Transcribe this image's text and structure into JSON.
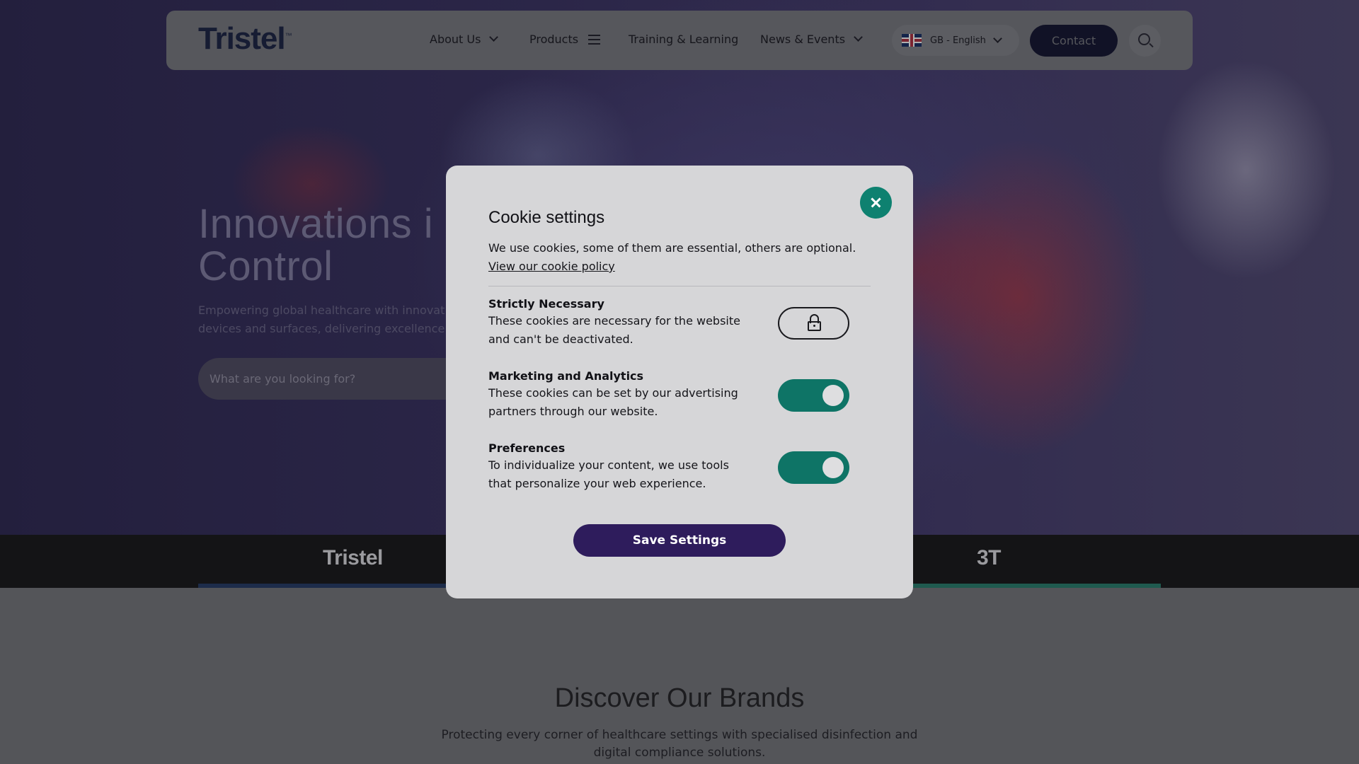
{
  "nav": {
    "logo": "Tristel",
    "logo_tm": "™",
    "items": [
      {
        "label": "About Us",
        "icon": "chevron-down-icon"
      },
      {
        "label": "Products",
        "icon": "hamburger-menu-icon"
      },
      {
        "label": "Training & Learning"
      },
      {
        "label": "News & Events",
        "icon": "chevron-down-icon"
      }
    ],
    "language": "GB - English",
    "contact_label": "Contact"
  },
  "hero": {
    "title_line1": "Innovations i",
    "title_line2": "Control",
    "subtitle_line1": "Empowering global healthcare with innovat",
    "subtitle_line2": "devices and surfaces, delivering excellence",
    "search_placeholder": "What are you looking for?"
  },
  "brands": {
    "left_logo": "Tristel",
    "right_logo": "3T"
  },
  "discover": {
    "title": "Discover Our Brands",
    "subtitle": "Protecting every corner of healthcare settings with specialised disinfection and digital compliance solutions."
  },
  "modal": {
    "title": "Cookie settings",
    "intro": "We use cookies, some of them are essential, others are optional.",
    "policy_link": "View our cookie policy",
    "categories": [
      {
        "title": "Strictly Necessary",
        "desc": "These cookies are necessary for the website and can't be deactivated.",
        "state": "locked"
      },
      {
        "title": "Marketing and Analytics",
        "desc": "These cookies can be set by our advertising partners through our website.",
        "state": "on"
      },
      {
        "title": "Preferences",
        "desc": "To individualize your content, we use tools that personalize your web experience.",
        "state": "on"
      }
    ],
    "save_label": "Save Settings"
  },
  "colors": {
    "accent_teal": "#0e8170",
    "toggle_on": "#0e7466",
    "save_button": "#2e1c5c",
    "contact_button": "#111226"
  }
}
